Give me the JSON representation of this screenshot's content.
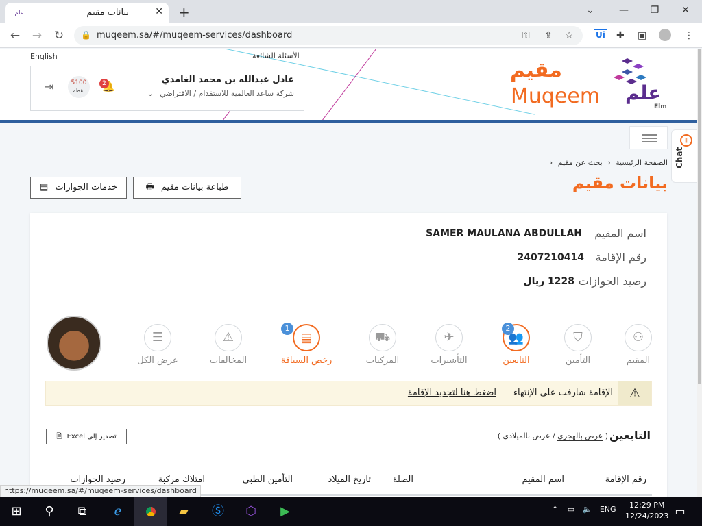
{
  "browser": {
    "tab_title": "بيانات مقيم",
    "tab_favicon_text": "علم",
    "url": "muqeem.sa/#/muqeem-services/dashboard",
    "status_url": "https://muqeem.sa/#/muqeem-services/dashboard"
  },
  "header": {
    "language": "English",
    "faq": "الأسئلة الشائعة",
    "user_name": "عادل عبدالله بن محمد الغامدي",
    "user_company": "شركة ساعد العالمية للاستقدام / الافتراضي",
    "points_value": "5100",
    "points_label": "نقطة",
    "notifications_count": "2",
    "logo_muqeem_ar": "مقيم",
    "logo_muqeem_en": "Muqeem",
    "logo_elm_ar": "علم",
    "logo_elm_en": "Elm"
  },
  "chat": {
    "label": "Chat"
  },
  "breadcrumb": {
    "home": "الصفحة الرئيسية",
    "search": "بحث عن مقيم"
  },
  "page": {
    "title": "بيانات مقيم",
    "print_button": "طباعة بيانات مقيم",
    "passport_button": "خدمات الجوازات"
  },
  "resident": {
    "name_label": "اسم المقيم",
    "name_value": "SAMER MAULANA ABDULLAH",
    "iqama_label": "رقم الإقامة",
    "iqama_value": "2407210414",
    "balance_label": "رصيد الجوازات",
    "balance_value": "1228 ريال"
  },
  "tabs": [
    {
      "label": "المقيم",
      "icon": "person-icon"
    },
    {
      "label": "التأمين",
      "icon": "shield-icon"
    },
    {
      "label": "التابعين",
      "icon": "family-icon",
      "badge": "2"
    },
    {
      "label": "التأشيرات",
      "icon": "plane-icon"
    },
    {
      "label": "المركبات",
      "icon": "car-icon"
    },
    {
      "label": "رخص السياقة",
      "icon": "license-icon",
      "badge": "1"
    },
    {
      "label": "المخالفات",
      "icon": "warning-icon"
    },
    {
      "label": "عرض الكل",
      "icon": "list-icon"
    }
  ],
  "alert": {
    "message": "الإقامة شارفت على الإنتهاء",
    "link": "اضغط هنا لتجديد الإقامة"
  },
  "dependents": {
    "title": "التابعين",
    "toggle_open": "(",
    "toggle_hijri": "عرض بالهجري",
    "toggle_sep": "/",
    "toggle_gregorian": "عرض بالميلادي",
    "toggle_close": ")",
    "export_button": "تصدير إلى Excel",
    "columns": [
      "رقم الإقامة",
      "اسم المقيم",
      "الصلة",
      "تاريخ الميلاد",
      "التأمين الطبي",
      "امتلاك مركبة",
      "رصيد الجوازات"
    ]
  },
  "taskbar": {
    "language": "ENG",
    "time": "12:29 PM",
    "date": "12/24/2023"
  },
  "colors": {
    "accent": "#f26b21",
    "brand_purple": "#5b2d8e",
    "header_line": "#2e5f9e",
    "badge_blue": "#4a90d9"
  }
}
